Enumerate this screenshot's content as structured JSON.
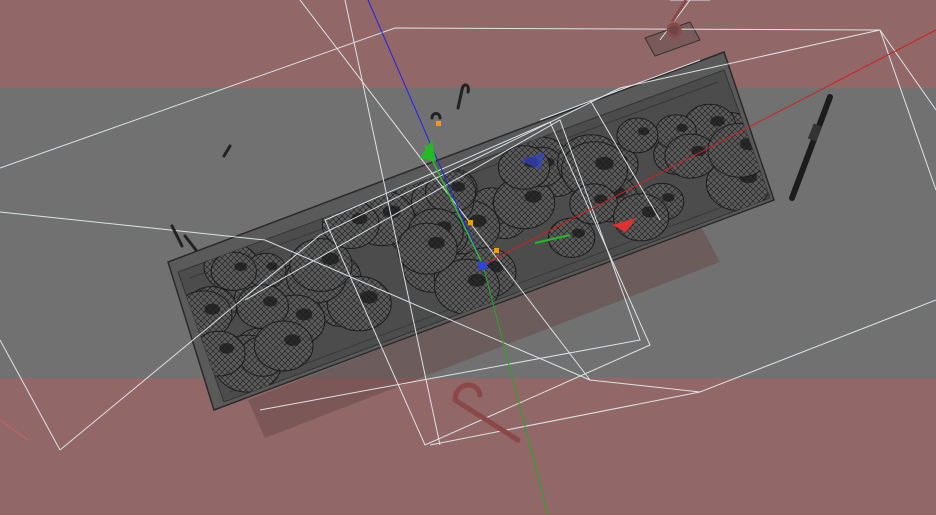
{
  "viewport": {
    "mode": "perspective-3d",
    "shading": "wireframe-on-shaded",
    "background_color": "#717171",
    "safe_frame_overlay_color": "#9a6464"
  },
  "scene": {
    "container": {
      "type": "rectangular-tray",
      "fill_color": "#4e4e4e",
      "rim_color": "#6a6a6a"
    },
    "items": {
      "type": "wireframe-spheres",
      "mesh_color": "#1e1e1e",
      "count_visible": 60
    },
    "stray_objects": [
      "candy-cane-a",
      "candy-cane-b",
      "candy-cane-c",
      "marker-pen",
      "small-hook"
    ],
    "frustum_color": "#e8f0f4"
  },
  "gizmo": {
    "x_axis_color": "#e02020",
    "y_axis_color": "#22bb22",
    "z_axis_color": "#2222ee",
    "pivot_color": "#3344cc",
    "handle_color": "#ff9900"
  }
}
